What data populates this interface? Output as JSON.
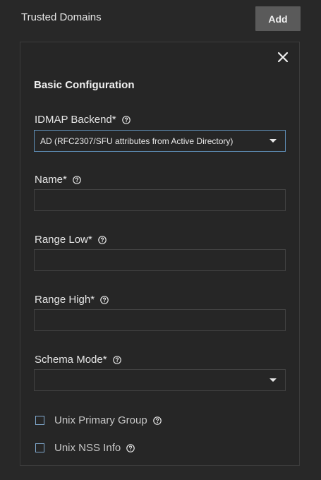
{
  "header": {
    "title": "Trusted Domains",
    "add_label": "Add"
  },
  "form": {
    "section_title": "Basic Configuration",
    "idmap_backend": {
      "label": "IDMAP Backend*",
      "value": "AD (RFC2307/SFU attributes from Active Directory)"
    },
    "name": {
      "label": "Name*",
      "value": ""
    },
    "range_low": {
      "label": "Range Low*",
      "value": ""
    },
    "range_high": {
      "label": "Range High*",
      "value": ""
    },
    "schema_mode": {
      "label": "Schema Mode*",
      "value": ""
    },
    "unix_primary_group": {
      "label": "Unix Primary Group",
      "checked": false
    },
    "unix_nss_info": {
      "label": "Unix NSS Info",
      "checked": false
    }
  },
  "icons": {
    "close": "close-icon",
    "help": "help-circle-icon",
    "dropdown": "caret-down-icon"
  },
  "colors": {
    "background": "#282828",
    "card_border": "#3b3b3b",
    "button_bg": "#5a5a5a",
    "focus_border": "#5f8fb8",
    "checkbox_border": "#7fa7cc"
  }
}
